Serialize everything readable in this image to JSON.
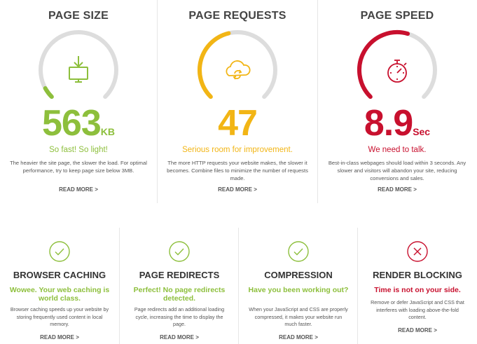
{
  "metrics": [
    {
      "title": "PAGE SIZE",
      "value": "563",
      "unit": "KB",
      "status": "So fast! So light!",
      "desc": "The heavier the site page, the slower the load. For optimal performance, try to keep page size below 3MB.",
      "more": "READ MORE >",
      "color": "#8dbf3c",
      "icon": "download-monitor-icon",
      "gauge_level": 0.06
    },
    {
      "title": "PAGE REQUESTS",
      "value": "47",
      "unit": "",
      "status": "Serious room for improvement.",
      "desc": "The more HTTP requests your website makes, the slower it becomes. Combine files to minimize the number of requests made.",
      "more": "READ MORE >",
      "color": "#f2b515",
      "icon": "cloud-sync-icon",
      "gauge_level": 0.45
    },
    {
      "title": "PAGE SPEED",
      "value": "8.9",
      "unit": "Sec",
      "status": "We need to talk.",
      "desc": "Best-in-class webpages should load within 3 seconds. Any slower and visitors will abandon your site, reducing conversions and sales.",
      "more": "READ MORE >",
      "color": "#c8102e",
      "icon": "stopwatch-icon",
      "gauge_level": 0.56
    }
  ],
  "checks": [
    {
      "title": "BROWSER CACHING",
      "tag": "Wowee. Your web caching is world class.",
      "desc": "Browser caching speeds up your website by storing frequently used content in local memory.",
      "more": "READ MORE >",
      "status": "pass",
      "color": "#8dbf3c",
      "icon": "check-circle-icon"
    },
    {
      "title": "PAGE REDIRECTS",
      "tag": "Perfect! No page redirects detected.",
      "desc": "Page redirects add an additional loading cycle, increasing the time to display the page.",
      "more": "READ MORE >",
      "status": "pass",
      "color": "#8dbf3c",
      "icon": "check-circle-icon"
    },
    {
      "title": "COMPRESSION",
      "tag": "Have you been working out?",
      "desc": "When your JavaScript and CSS are properly compressed, it makes your website run much faster.",
      "more": "READ MORE >",
      "status": "pass",
      "color": "#8dbf3c",
      "icon": "check-circle-icon"
    },
    {
      "title": "RENDER BLOCKING",
      "tag": "Time is not on your side.",
      "desc": "Remove or defer JavaScript and CSS that interferes with loading above-the-fold content.",
      "more": "READ MORE >",
      "status": "fail",
      "color": "#c8102e",
      "icon": "x-circle-icon"
    }
  ]
}
